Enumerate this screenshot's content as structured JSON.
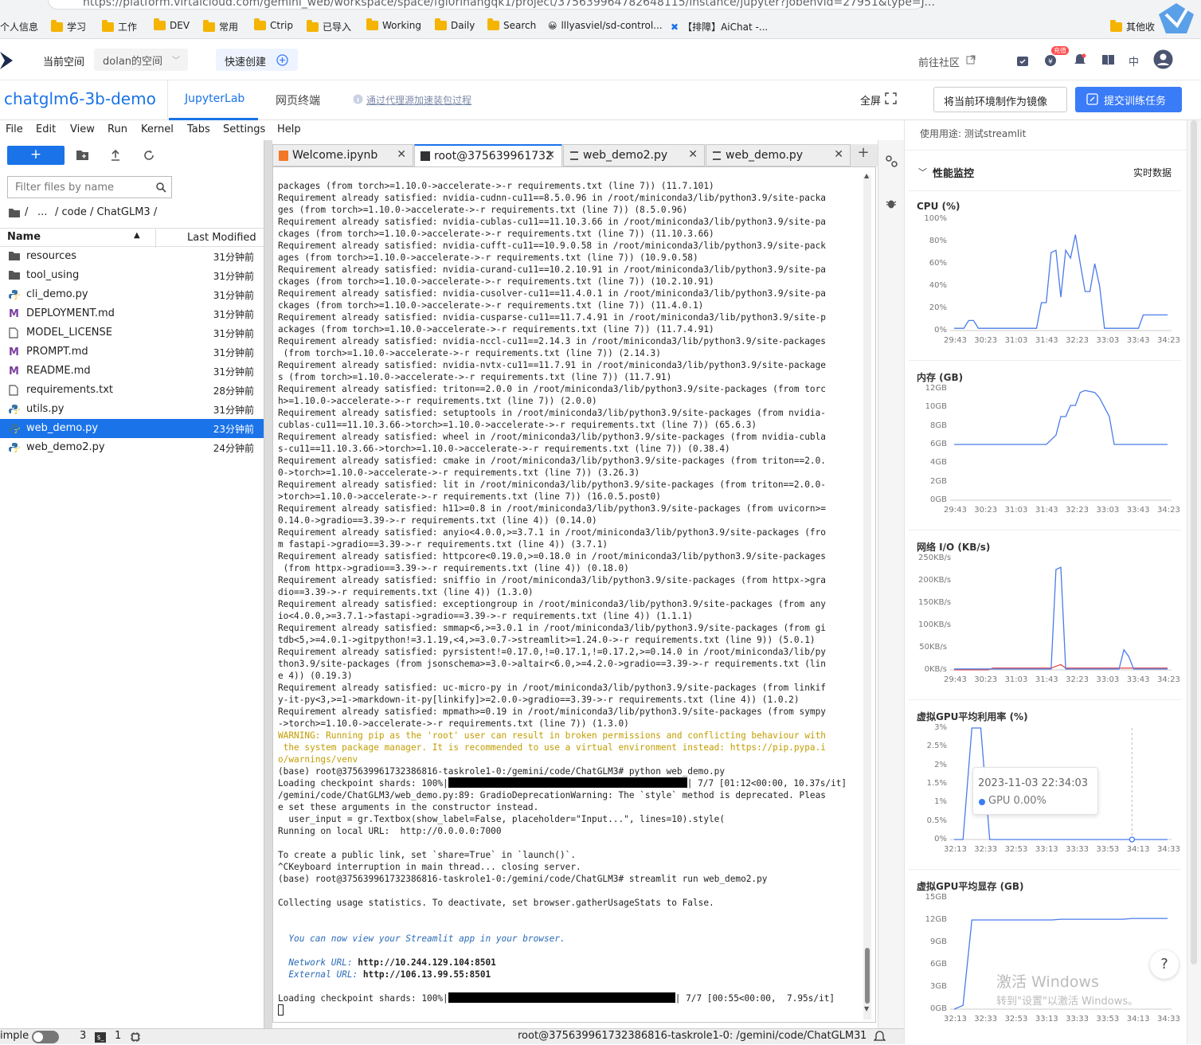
{
  "browser": {
    "url": "https://platform.virtaicloud.com/gemini_web/workspace/space/fgl0rlhangqk1/project/375639964782648115/instance/jupyter?jobenvid=27951&type=j...",
    "bookmarks": [
      "个人信息",
      "学习",
      "工作",
      "DEV",
      "常用",
      "Ctrip",
      "已导入",
      "Working",
      "Daily",
      "Search",
      "lllyasviel/sd-control...",
      "【排障】AiChat -...",
      "其他收"
    ]
  },
  "header": {
    "current_space_label": "当前空间",
    "space_name": "dolan的空间",
    "quick_create": "快速创建",
    "community": "前往社区",
    "recharge_badge": "充值",
    "lang": "中"
  },
  "subheader": {
    "project": "chatglm6-3b-demo",
    "tab_jupyter": "JupyterLab",
    "tab_terminal": "网页终端",
    "proxy_hint": "通过代理源加速装包过程",
    "fullscreen": "全屏",
    "make_image": "将当前环境制作为镜像",
    "submit": "提交训练任务"
  },
  "menu": [
    "File",
    "Edit",
    "View",
    "Run",
    "Kernel",
    "Tabs",
    "Settings",
    "Help"
  ],
  "filebrowser": {
    "filter_placeholder": "Filter files by name",
    "path": [
      "/",
      "...",
      "/ code / ChatGLM3 /"
    ],
    "col_name": "Name",
    "col_modified": "Last Modified",
    "files": [
      {
        "name": "resources",
        "mod": "31分钟前",
        "type": "folder"
      },
      {
        "name": "tool_using",
        "mod": "31分钟前",
        "type": "folder"
      },
      {
        "name": "cli_demo.py",
        "mod": "31分钟前",
        "type": "py"
      },
      {
        "name": "DEPLOYMENT.md",
        "mod": "31分钟前",
        "type": "md"
      },
      {
        "name": "MODEL_LICENSE",
        "mod": "31分钟前",
        "type": "file"
      },
      {
        "name": "PROMPT.md",
        "mod": "31分钟前",
        "type": "md"
      },
      {
        "name": "README.md",
        "mod": "31分钟前",
        "type": "md"
      },
      {
        "name": "requirements.txt",
        "mod": "28分钟前",
        "type": "file"
      },
      {
        "name": "utils.py",
        "mod": "31分钟前",
        "type": "py"
      },
      {
        "name": "web_demo.py",
        "mod": "23分钟前",
        "type": "py"
      },
      {
        "name": "web_demo2.py",
        "mod": "24分钟前",
        "type": "py"
      }
    ]
  },
  "tabs": [
    {
      "label": "Welcome.ipynb"
    },
    {
      "label": "root@375639961732"
    },
    {
      "label": "web_demo2.py"
    },
    {
      "label": "web_demo.py"
    }
  ],
  "terminal": {
    "lines": [
      "packages (from torch>=1.10.0->accelerate->-r requirements.txt (line 7)) (11.7.101)",
      "Requirement already satisfied: nvidia-cudnn-cu11==8.5.0.96 in /root/miniconda3/lib/python3.9/site-packa",
      "ges (from torch>=1.10.0->accelerate->-r requirements.txt (line 7)) (8.5.0.96)",
      "Requirement already satisfied: nvidia-cublas-cu11==11.10.3.66 in /root/miniconda3/lib/python3.9/site-pa",
      "ckages (from torch>=1.10.0->accelerate->-r requirements.txt (line 7)) (11.10.3.66)",
      "Requirement already satisfied: nvidia-cufft-cu11==10.9.0.58 in /root/miniconda3/lib/python3.9/site-pack",
      "ages (from torch>=1.10.0->accelerate->-r requirements.txt (line 7)) (10.9.0.58)",
      "Requirement already satisfied: nvidia-curand-cu11==10.2.10.91 in /root/miniconda3/lib/python3.9/site-pa",
      "ckages (from torch>=1.10.0->accelerate->-r requirements.txt (line 7)) (10.2.10.91)",
      "Requirement already satisfied: nvidia-cusolver-cu11==11.4.0.1 in /root/miniconda3/lib/python3.9/site-pa",
      "ckages (from torch>=1.10.0->accelerate->-r requirements.txt (line 7)) (11.4.0.1)",
      "Requirement already satisfied: nvidia-cusparse-cu11==11.7.4.91 in /root/miniconda3/lib/python3.9/site-p",
      "ackages (from torch>=1.10.0->accelerate->-r requirements.txt (line 7)) (11.7.4.91)",
      "Requirement already satisfied: nvidia-nccl-cu11==2.14.3 in /root/miniconda3/lib/python3.9/site-packages",
      " (from torch>=1.10.0->accelerate->-r requirements.txt (line 7)) (2.14.3)",
      "Requirement already satisfied: nvidia-nvtx-cu11==11.7.91 in /root/miniconda3/lib/python3.9/site-package",
      "s (from torch>=1.10.0->accelerate->-r requirements.txt (line 7)) (11.7.91)",
      "Requirement already satisfied: triton==2.0.0 in /root/miniconda3/lib/python3.9/site-packages (from torc",
      "h>=1.10.0->accelerate->-r requirements.txt (line 7)) (2.0.0)",
      "Requirement already satisfied: setuptools in /root/miniconda3/lib/python3.9/site-packages (from nvidia-",
      "cublas-cu11==11.10.3.66->torch>=1.10.0->accelerate->-r requirements.txt (line 7)) (65.6.3)",
      "Requirement already satisfied: wheel in /root/miniconda3/lib/python3.9/site-packages (from nvidia-cubla",
      "s-cu11==11.10.3.66->torch>=1.10.0->accelerate->-r requirements.txt (line 7)) (0.38.4)",
      "Requirement already satisfied: cmake in /root/miniconda3/lib/python3.9/site-packages (from triton==2.0.",
      "0->torch>=1.10.0->accelerate->-r requirements.txt (line 7)) (3.26.3)",
      "Requirement already satisfied: lit in /root/miniconda3/lib/python3.9/site-packages (from triton==2.0.0-",
      ">torch>=1.10.0->accelerate->-r requirements.txt (line 7)) (16.0.5.post0)",
      "Requirement already satisfied: h11>=0.8 in /root/miniconda3/lib/python3.9/site-packages (from uvicorn>=",
      "0.14.0->gradio==3.39->-r requirements.txt (line 4)) (0.14.0)",
      "Requirement already satisfied: anyio<4.0.0,>=3.7.1 in /root/miniconda3/lib/python3.9/site-packages (fro",
      "m fastapi->gradio==3.39->-r requirements.txt (line 4)) (3.7.1)",
      "Requirement already satisfied: httpcore<0.19.0,>=0.18.0 in /root/miniconda3/lib/python3.9/site-packages",
      " (from httpx->gradio==3.39->-r requirements.txt (line 4)) (0.18.0)",
      "Requirement already satisfied: sniffio in /root/miniconda3/lib/python3.9/site-packages (from httpx->gra",
      "dio==3.39->-r requirements.txt (line 4)) (1.3.0)",
      "Requirement already satisfied: exceptiongroup in /root/miniconda3/lib/python3.9/site-packages (from any",
      "io<4.0.0,>=3.7.1->fastapi->gradio==3.39->-r requirements.txt (line 4)) (1.1.1)",
      "Requirement already satisfied: smmap<6,>=3.0.1 in /root/miniconda3/lib/python3.9/site-packages (from gi",
      "tdb<5,>=4.0.1->gitpython!=3.1.19,<4,>=3.0.7->streamlit>=1.24.0->-r requirements.txt (line 9)) (5.0.1)",
      "Requirement already satisfied: pyrsistent!=0.17.0,!=0.17.1,!=0.17.2,>=0.14.0 in /root/miniconda3/lib/py",
      "thon3.9/site-packages (from jsonschema>=3.0->altair<6.0,>=4.2.0->gradio==3.39->-r requirements.txt (lin",
      "e 4)) (0.19.3)",
      "Requirement already satisfied: uc-micro-py in /root/miniconda3/lib/python3.9/site-packages (from linkif",
      "y-it-py<3,>=1->markdown-it-py[linkify]>=2.0.0->gradio==3.39->-r requirements.txt (line 4)) (1.0.2)",
      "Requirement already satisfied: mpmath>=0.19 in /root/miniconda3/lib/python3.9/site-packages (from sympy",
      "->torch>=1.10.0->accelerate->-r requirements.txt (line 7)) (1.3.0)"
    ],
    "warning": [
      "WARNING: Running pip as the 'root' user can result in broken permissions and conflicting behaviour with",
      " the system package manager. It is recommended to use a virtual environment instead: https://pip.pypa.i",
      "o/warnings/venv"
    ],
    "cmd1": "(base) root@375639961732386816-taskrole1-0:/gemini/code/ChatGLM3# python web_demo.py",
    "ckpt1_pre": "Loading checkpoint shards: 100%|",
    "ckpt1_post": "| 7/7 [01:12<00:00, 10.37s/it]",
    "after1": [
      "/gemini/code/ChatGLM3/web_demo.py:89: GradioDeprecationWarning: The `style` method is deprecated. Pleas",
      "e set these arguments in the constructor instead.",
      "  user_input = gr.Textbox(show_label=False, placeholder=\"Input...\", lines=10).style(",
      "Running on local URL:  http://0.0.0.0:7000",
      "",
      "To create a public link, set `share=True` in `launch()`.",
      "^CKeyboard interruption in main thread... closing server.",
      "(base) root@375639961732386816-taskrole1-0:/gemini/code/ChatGLM3# streamlit run web_demo2.py",
      "",
      "Collecting usage statistics. To deactivate, set browser.gatherUsageStats to False.",
      "",
      ""
    ],
    "st_view": "  You can now view your Streamlit app in your browser.",
    "net_label": "  Network URL: ",
    "net_url": "http://10.244.129.104:8501",
    "ext_label": "  External URL: ",
    "ext_url": "http://106.13.99.55:8501",
    "ckpt2_pre": "Loading checkpoint shards: 100%|",
    "ckpt2_post": "| 7/7 [00:55<00:00,  7.95s/it]"
  },
  "monitor": {
    "usage": "使用用途: 测试streamlit",
    "title": "性能监控",
    "realtime": "实时数据",
    "cpu": {
      "title": "CPU (%)",
      "yticks": [
        "100%",
        "80%",
        "60%",
        "40%",
        "20%",
        "0%"
      ],
      "xticks": [
        "29:43",
        "30:23",
        "31:03",
        "31:43",
        "32:23",
        "33:03",
        "33:43",
        "34:23"
      ],
      "color": "#4a7bea",
      "values": [
        2,
        2,
        2,
        9,
        9,
        2,
        2,
        2,
        2,
        2,
        2,
        2,
        2,
        2,
        2,
        2,
        2,
        2,
        25,
        25,
        70,
        72,
        30,
        72,
        65,
        86,
        60,
        35,
        35,
        60,
        40,
        2,
        2,
        2,
        2,
        2,
        2,
        2,
        2,
        14,
        14,
        14,
        14,
        14,
        14
      ]
    },
    "mem": {
      "title": "内存 (GB)",
      "yticks": [
        "12GB",
        "10GB",
        "8GB",
        "6GB",
        "4GB",
        "2GB",
        "0GB"
      ],
      "xticks": [
        "29:43",
        "30:23",
        "31:03",
        "31:43",
        "32:23",
        "33:03",
        "33:43",
        "34:23"
      ],
      "color": "#4a7bea",
      "values": [
        6,
        6,
        6,
        6,
        6,
        6,
        6,
        6,
        6,
        6,
        6,
        6,
        6,
        6,
        6,
        6,
        6,
        6,
        6,
        6,
        6.5,
        7,
        9,
        9,
        10.2,
        10.2,
        11.6,
        11.8,
        11.7,
        11.6,
        11,
        10,
        9,
        6,
        6,
        6,
        6,
        6,
        6,
        6,
        6,
        6,
        6,
        6,
        6
      ]
    },
    "net": {
      "title": "网络 I/O (KB/s)",
      "yticks": [
        "250KB/s",
        "200KB/s",
        "150KB/s",
        "100KB/s",
        "50KB/s",
        "0KB/s"
      ],
      "xticks": [
        "29:43",
        "30:23",
        "31:03",
        "31:43",
        "32:23",
        "33:03",
        "33:43",
        "34:23"
      ],
      "color": "#4a7bea",
      "color2": "#e05050",
      "values": [
        2,
        2,
        2,
        2,
        2,
        2,
        2,
        2,
        2,
        2,
        2,
        2,
        2,
        2,
        2,
        2,
        2,
        2,
        2,
        2,
        2,
        225,
        230,
        2,
        2,
        2,
        2,
        2,
        2,
        2,
        2,
        2,
        2,
        2,
        2,
        45,
        30,
        2,
        2,
        2,
        2,
        2,
        2,
        2,
        2
      ],
      "values2": [
        0,
        0,
        0,
        0,
        0,
        0,
        0,
        0,
        4,
        4,
        4,
        4,
        4,
        4,
        4,
        4,
        4,
        4,
        4,
        4,
        4,
        8,
        12,
        4,
        4,
        4,
        4,
        4,
        4,
        4,
        4,
        4,
        4,
        4,
        4,
        4,
        4,
        4,
        4,
        4,
        4,
        4,
        4,
        4,
        4
      ]
    },
    "gpu": {
      "title": "虚拟GPU平均利用率 (%)",
      "yticks": [
        "3%",
        "2.5%",
        "2%",
        "1.5%",
        "1%",
        "0.5%",
        "0%"
      ],
      "xticks": [
        "32:13",
        "32:33",
        "32:53",
        "33:13",
        "33:33",
        "33:53",
        "34:13",
        "34:33"
      ],
      "color": "#4a7bea",
      "values": [
        0,
        0,
        3,
        3,
        0,
        0,
        0,
        0,
        0,
        0,
        0,
        0,
        0,
        0,
        0,
        0,
        0,
        0,
        0,
        0,
        0,
        0,
        0,
        0,
        0
      ],
      "tooltip_time": "2023-11-03 22:34:03",
      "tooltip_val": "GPU 0.00%"
    },
    "gpumem": {
      "title": "虚拟GPU平均显存 (GB)",
      "yticks": [
        "15GB",
        "12GB",
        "9GB",
        "6GB",
        "3GB",
        "0GB"
      ],
      "xticks": [
        "32:13",
        "32:33",
        "32:53",
        "33:13",
        "33:33",
        "33:53",
        "34:13",
        "34:33"
      ],
      "color": "#4a7bea",
      "values": [
        0,
        0.5,
        12,
        12,
        12,
        12,
        12,
        12,
        12,
        12,
        12,
        12,
        12.1,
        12.1,
        12.1,
        12.1,
        12.1,
        12.1,
        12.1,
        12.1,
        12.2,
        12.2,
        12.2,
        12.2,
        12.2
      ]
    }
  },
  "status": {
    "mode": "imple",
    "n1": "3",
    "n2": "1",
    "path": "root@375639961732386816-taskrole1-0: /gemini/code/ChatGLM3",
    "n3": "1"
  },
  "watermark": {
    "l1": "激活 Windows",
    "l2": "转到\"设置\"以激活 Windows。"
  },
  "help": "?"
}
